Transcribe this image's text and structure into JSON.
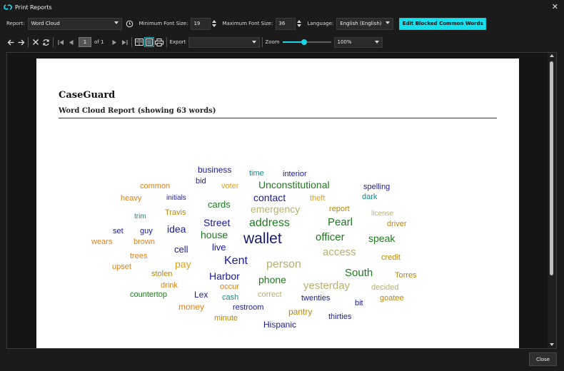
{
  "window": {
    "title": "Print Reports",
    "close_glyph": "✕"
  },
  "controls": {
    "report_label": "Report:",
    "report_value": "Word Cloud",
    "min_font_label": "Minimum Font Size:",
    "min_font_value": "19",
    "max_font_label": "Maximum Font Size:",
    "max_font_value": "36",
    "language_label": "Language:",
    "language_value": "English (English)",
    "edit_button": "Edit Blocked Common Words"
  },
  "toolbar": {
    "page_value": "1",
    "page_of": "of 1",
    "export_label": "Export",
    "export_value": "",
    "zoom_label": "Zoom",
    "zoom_fraction": 0.45,
    "zoom_value": "100%"
  },
  "report": {
    "title": "CaseGuard",
    "subtitle": "Word Cloud Report (showing 63 words)"
  },
  "colors": {
    "accent": "#16e0ee",
    "navy": "#1a1aa0",
    "green": "#1e7a1e",
    "teal": "#1a8a8a",
    "orange": "#e0801a",
    "gold": "#b8860b",
    "tan": "#b8b070"
  },
  "words": [
    {
      "text": "business",
      "color": "#1a1aa0"
    },
    {
      "text": "time",
      "color": "#1a8a8a"
    },
    {
      "text": "interior",
      "color": "#1a1aa0"
    },
    {
      "text": "bid",
      "color": "#1a1aa0"
    },
    {
      "text": "common",
      "color": "#e0801a"
    },
    {
      "text": "voter",
      "color": "#e0a020"
    },
    {
      "text": "Unconstitutional",
      "color": "#1e7a1e"
    },
    {
      "text": "spelling",
      "color": "#1a1aa0"
    },
    {
      "text": "heavy",
      "color": "#e0801a"
    },
    {
      "text": "initials",
      "color": "#1a1aa0"
    },
    {
      "text": "contact",
      "color": "#1a1aa0"
    },
    {
      "text": "theft",
      "color": "#e0a020"
    },
    {
      "text": "dark",
      "color": "#1a8a8a"
    },
    {
      "text": "cards",
      "color": "#1e7a1e"
    },
    {
      "text": "report",
      "color": "#b8860b"
    },
    {
      "text": "Travis",
      "color": "#b8860b"
    },
    {
      "text": "emergency",
      "color": "#b8b070"
    },
    {
      "text": "license",
      "color": "#b8b070"
    },
    {
      "text": "trim",
      "color": "#1a8a8a"
    },
    {
      "text": "Street",
      "color": "#1a1aa0"
    },
    {
      "text": "address",
      "color": "#1e7a1e"
    },
    {
      "text": "Pearl",
      "color": "#1e7a1e"
    },
    {
      "text": "driver",
      "color": "#b8860b"
    },
    {
      "text": "set",
      "color": "#1a1aa0"
    },
    {
      "text": "guy",
      "color": "#1a1aa0"
    },
    {
      "text": "idea",
      "color": "#1a1aa0"
    },
    {
      "text": "house",
      "color": "#1e7a1e"
    },
    {
      "text": "wallet",
      "color": "#1a1a6a"
    },
    {
      "text": "officer",
      "color": "#1e7a1e"
    },
    {
      "text": "speak",
      "color": "#1e7a1e"
    },
    {
      "text": "wears",
      "color": "#e0801a"
    },
    {
      "text": "brown",
      "color": "#e0801a"
    },
    {
      "text": "live",
      "color": "#1a1aa0"
    },
    {
      "text": "cell",
      "color": "#1a1aa0"
    },
    {
      "text": "access",
      "color": "#b8b070"
    },
    {
      "text": "trees",
      "color": "#e0801a"
    },
    {
      "text": "Kent",
      "color": "#1a1aa0"
    },
    {
      "text": "credit",
      "color": "#b8860b"
    },
    {
      "text": "pay",
      "color": "#e0a020"
    },
    {
      "text": "person",
      "color": "#b8b070"
    },
    {
      "text": "upset",
      "color": "#e0801a"
    },
    {
      "text": "stolen",
      "color": "#b8860b"
    },
    {
      "text": "Harbor",
      "color": "#1a1aa0"
    },
    {
      "text": "South",
      "color": "#1e7a1e"
    },
    {
      "text": "Torres",
      "color": "#b8860b"
    },
    {
      "text": "drink",
      "color": "#e0801a"
    },
    {
      "text": "phone",
      "color": "#1e7a1e"
    },
    {
      "text": "occur",
      "color": "#e0801a"
    },
    {
      "text": "yesterday",
      "color": "#b8b070"
    },
    {
      "text": "decided",
      "color": "#b8b070"
    },
    {
      "text": "countertop",
      "color": "#1e7a1e"
    },
    {
      "text": "Lex",
      "color": "#1a1aa0"
    },
    {
      "text": "cash",
      "color": "#1a8a8a"
    },
    {
      "text": "correct",
      "color": "#b8b070"
    },
    {
      "text": "twenties",
      "color": "#1a1aa0"
    },
    {
      "text": "goatee",
      "color": "#b8860b"
    },
    {
      "text": "bit",
      "color": "#1a1aa0"
    },
    {
      "text": "money",
      "color": "#e0801a"
    },
    {
      "text": "restroom",
      "color": "#1a1aa0"
    },
    {
      "text": "pantry",
      "color": "#b8860b"
    },
    {
      "text": "minute",
      "color": "#b8860b"
    },
    {
      "text": "thirties",
      "color": "#1a1aa0"
    },
    {
      "text": "Hispanic",
      "color": "#1a1aa0"
    }
  ],
  "footer": {
    "close_label": "Close"
  }
}
